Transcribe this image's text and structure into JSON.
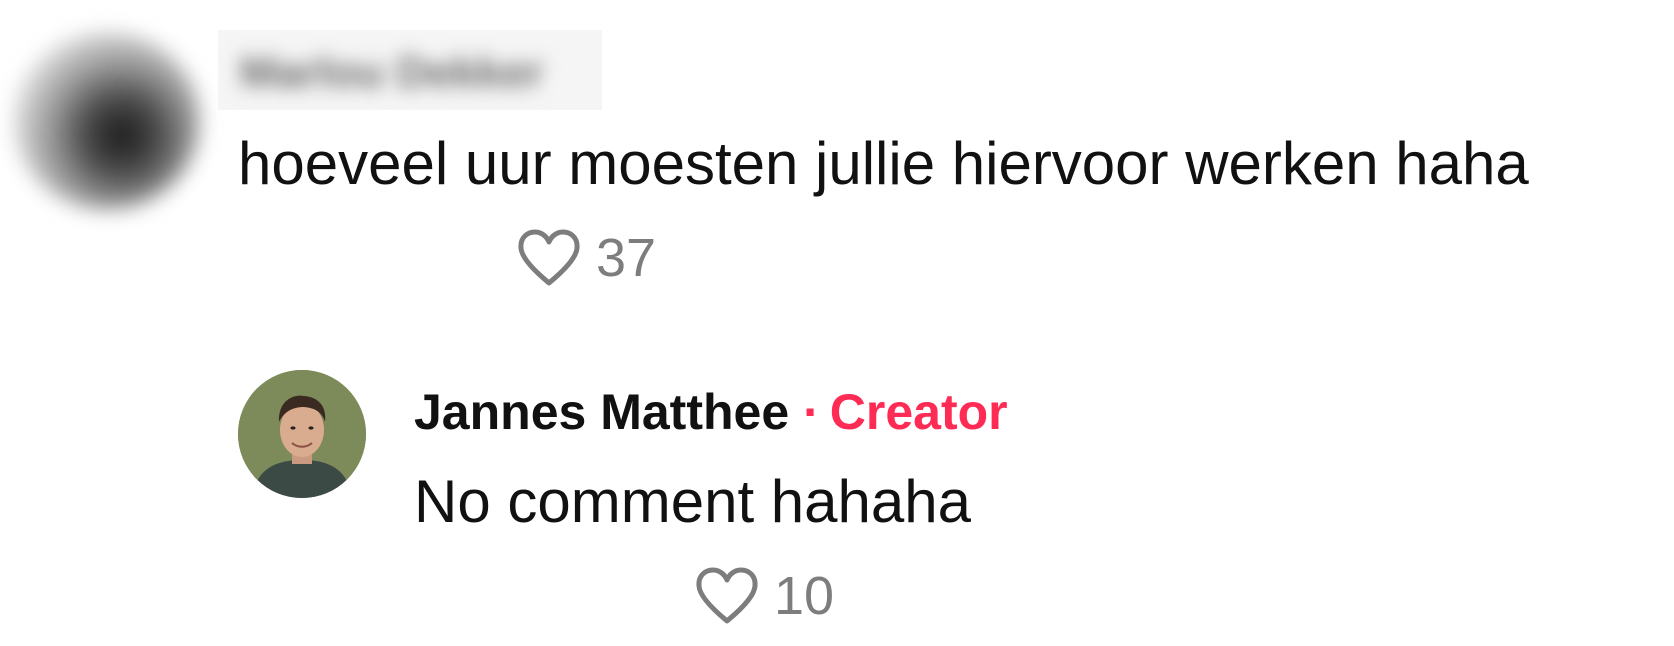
{
  "comment": {
    "username": "Marlou Dekker",
    "text": "hoeveel uur moesten jullie hiervoor werken haha",
    "likes": "37",
    "like_icon": "heart-outline-icon"
  },
  "reply": {
    "username": "Jannes Matthee",
    "separator": "·",
    "badge": "Creator",
    "text": "No comment hahaha",
    "likes": "10",
    "like_icon": "heart-outline-icon"
  },
  "colors": {
    "creator_accent": "#fe2c55",
    "count_gray": "#7d7d7d",
    "text": "#111111"
  }
}
